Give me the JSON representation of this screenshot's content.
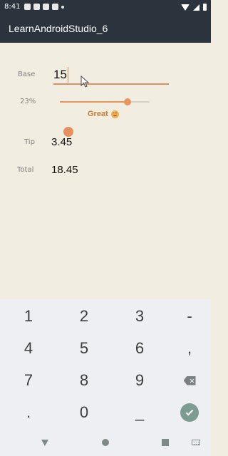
{
  "status": {
    "time": "8:41"
  },
  "app": {
    "title": "LearnAndroidStudio_6"
  },
  "form": {
    "base_label": "Base",
    "base_value": "15",
    "percent_label": "23%",
    "tip_percent_slider": 0.23,
    "quality_label": "Great",
    "quality_icon": "smiling-face-icon",
    "tip_label": "Tip",
    "tip_value": "3.45",
    "total_label": "Total",
    "total_value": "18.45"
  },
  "keyboard": {
    "rows": [
      [
        "1",
        "2",
        "3",
        "-"
      ],
      [
        "4",
        "5",
        "6",
        ","
      ],
      [
        "7",
        "8",
        "9",
        ""
      ],
      [
        ".",
        "0",
        "_",
        ""
      ]
    ],
    "backspace_icon": "backspace-icon",
    "done_icon": "check-icon"
  },
  "navigation": {
    "back_icon": "back-triangle-icon",
    "home_icon": "home-circle-icon",
    "recent_icon": "recent-apps-square-icon",
    "keyboard_icon": "keyboard-icon"
  },
  "colors": {
    "app_bar": "#2b343d",
    "background": "#f2ede1",
    "accent": "#e8955d",
    "great_text": "#c57933",
    "keyboard_bg": "#edeff2"
  }
}
